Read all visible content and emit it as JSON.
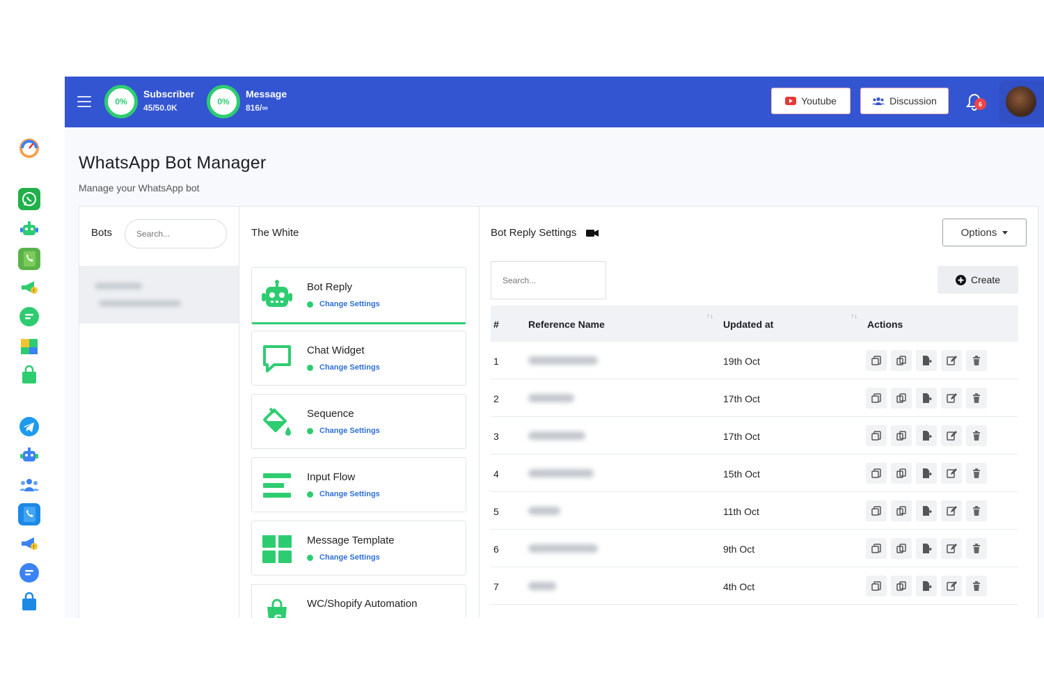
{
  "header": {
    "subscriber": {
      "percent": "0%",
      "label": "Subscriber",
      "value": "45/50.0K"
    },
    "message": {
      "percent": "0%",
      "label": "Message",
      "value": "816/∞"
    },
    "youtube_label": "Youtube",
    "discussion_label": "Discussion",
    "notification_count": "6"
  },
  "page": {
    "title": "WhatsApp Bot Manager",
    "subtitle": "Manage your WhatsApp bot"
  },
  "bots_panel": {
    "heading": "Bots",
    "search_placeholder": "Search..."
  },
  "bot_menu": {
    "heading": "The White",
    "change_label": "Change Settings",
    "items": [
      {
        "title": "Bot Reply",
        "icon": "robot-icon"
      },
      {
        "title": "Chat Widget",
        "icon": "chat-widget-icon"
      },
      {
        "title": "Sequence",
        "icon": "paint-bucket-icon"
      },
      {
        "title": "Input Flow",
        "icon": "input-flow-icon"
      },
      {
        "title": "Message Template",
        "icon": "grid-template-icon"
      },
      {
        "title": "WC/Shopify Automation",
        "icon": "shopify-bag-icon"
      }
    ]
  },
  "settings": {
    "heading": "Bot Reply Settings",
    "options_label": "Options",
    "search_placeholder": "Search...",
    "create_label": "Create",
    "columns": [
      "#",
      "Reference Name",
      "Updated at",
      "Actions"
    ],
    "rows": [
      {
        "num": "1",
        "updated": "19th Oct"
      },
      {
        "num": "2",
        "updated": "17th Oct"
      },
      {
        "num": "3",
        "updated": "17th Oct"
      },
      {
        "num": "4",
        "updated": "15th Oct"
      },
      {
        "num": "5",
        "updated": "11th Oct"
      },
      {
        "num": "6",
        "updated": "9th Oct"
      },
      {
        "num": "7",
        "updated": "4th Oct"
      }
    ]
  },
  "colors": {
    "header_blue": "#3455d1",
    "accent_green": "#2ecc71",
    "link_blue": "#2f6fd6",
    "badge_red": "#ef4444"
  }
}
